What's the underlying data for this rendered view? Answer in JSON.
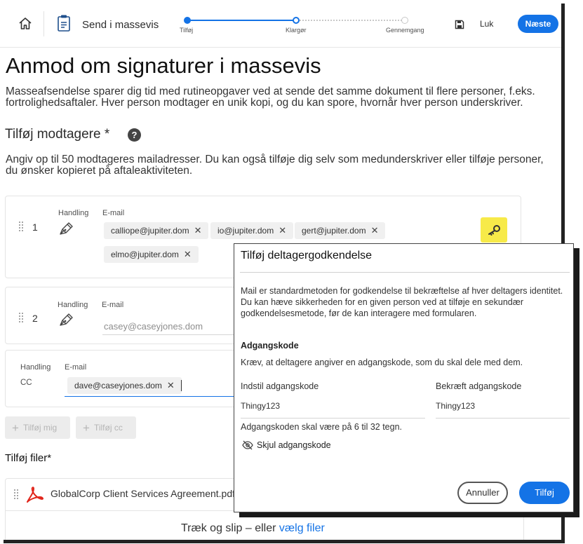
{
  "header": {
    "title": "Send i massevis",
    "steps": [
      "Tilføj",
      "Klargør",
      "Gennemgang"
    ],
    "close_label": "Luk",
    "next_label": "Næste"
  },
  "page": {
    "title": "Anmod om signaturer i massevis",
    "intro": "Masseafsendelse sparer dig tid med rutineopgaver ved at sende det samme dokument til flere personer, f.eks. fortrolighedsaftaler. Hver person modtager en unik kopi, og du kan spore, hvornår hver person underskriver.",
    "recipients_title": "Tilføj modtagere",
    "required_mark": "*",
    "help_symbol": "?",
    "recipients_desc": "Angiv op til 50 modtageres mailadresser. Du kan også tilføje dig selv som medunderskriver eller tilføje personer, du ønsker kopieret på aftaleaktiviteten."
  },
  "recipients": [
    {
      "number": "1",
      "action_label": "Handling",
      "email_label": "E-mail",
      "emails": [
        "calliope@jupiter.dom",
        "io@jupiter.dom",
        "gert@jupiter.dom",
        "elmo@jupiter.dom"
      ]
    },
    {
      "number": "2",
      "action_label": "Handling",
      "email_label": "E-mail",
      "email_placeholder": "casey@caseyjones.dom"
    }
  ],
  "cc": {
    "action_label": "Handling",
    "email_label": "E-mail",
    "type": "CC",
    "emails": [
      "dave@caseyjones.dom"
    ]
  },
  "buttons": {
    "add_me": "Tilføj mig",
    "add_cc": "Tilføj cc"
  },
  "files": {
    "title": "Tilføj filer",
    "required_mark": "*",
    "file_name": "GlobalCorp Client Services Agreement.pdf",
    "drop_text": "Træk og slip – eller ",
    "drop_link": "vælg filer"
  },
  "dialog": {
    "title": "Tilføj deltagergodkendelse",
    "description": "Mail er standardmetoden for godkendelse til bekræftelse af hver deltagers identitet. Du kan hæve sikkerheden for en given person ved at tilføje en sekundær godkendelsesmetode, før de kan interagere med formularen.",
    "method_title": "Adgangskode",
    "method_desc": "Kræv, at deltagere angiver en adgangskode, som du skal dele med dem.",
    "set_password_label": "Indstil adgangskode",
    "confirm_password_label": "Bekræft adgangskode",
    "password_value": "Thingy123",
    "confirm_value": "Thingy123",
    "hint": "Adgangskoden skal være på 6 til 32 tegn.",
    "toggle_label": "Skjul adgangskode",
    "cancel_label": "Annuller",
    "add_label": "Tilføj"
  },
  "colors": {
    "accent": "#1473e6",
    "key_highlight": "#f7ea49",
    "pdf_red": "#e1251b"
  }
}
